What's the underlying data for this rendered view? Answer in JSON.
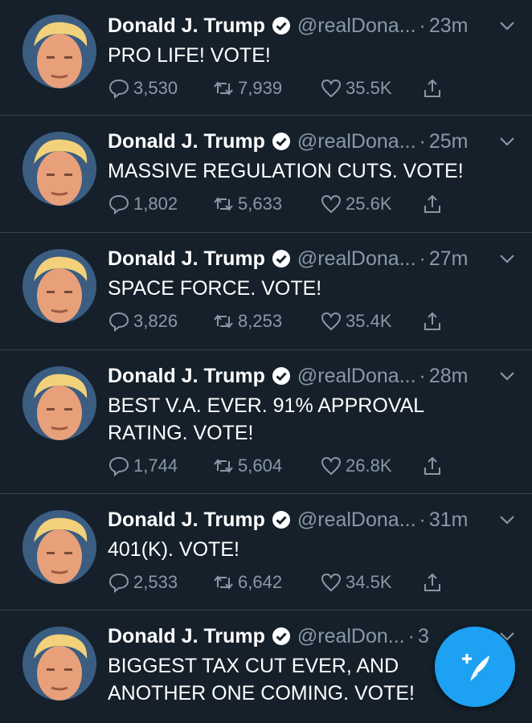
{
  "colors": {
    "background": "#15202b",
    "secondary_text": "#8899a6",
    "accent": "#1da1f2",
    "divider": "#38444d"
  },
  "tweets": [
    {
      "name": "Donald J. Trump",
      "handle": "@realDona...",
      "time": "23m",
      "text": "PRO LIFE! VOTE!",
      "replies": "3,530",
      "retweets": "7,939",
      "likes": "35.5K"
    },
    {
      "name": "Donald J. Trump",
      "handle": "@realDona...",
      "time": "25m",
      "text": "MASSIVE REGULATION CUTS. VOTE!",
      "replies": "1,802",
      "retweets": "5,633",
      "likes": "25.6K"
    },
    {
      "name": "Donald J. Trump",
      "handle": "@realDona...",
      "time": "27m",
      "text": "SPACE FORCE. VOTE!",
      "replies": "3,826",
      "retweets": "8,253",
      "likes": "35.4K"
    },
    {
      "name": "Donald J. Trump",
      "handle": "@realDona...",
      "time": "28m",
      "text": "BEST V.A. EVER. 91% APPROVAL RATING. VOTE!",
      "replies": "1,744",
      "retweets": "5,604",
      "likes": "26.8K"
    },
    {
      "name": "Donald J. Trump",
      "handle": "@realDona...",
      "time": "31m",
      "text": "401(K). VOTE!",
      "replies": "2,533",
      "retweets": "6,642",
      "likes": "34.5K"
    },
    {
      "name": "Donald J. Trump",
      "handle": "@realDon...",
      "time": "3",
      "text": "BIGGEST TAX CUT EVER, AND ANOTHER ONE COMING. VOTE!",
      "replies": "",
      "retweets": "",
      "likes": ""
    }
  ],
  "icons": {
    "verified": "verified-badge-icon",
    "caret": "chevron-down-icon",
    "reply": "reply-icon",
    "retweet": "retweet-icon",
    "like": "heart-icon",
    "share": "share-icon",
    "compose": "compose-tweet-icon"
  }
}
